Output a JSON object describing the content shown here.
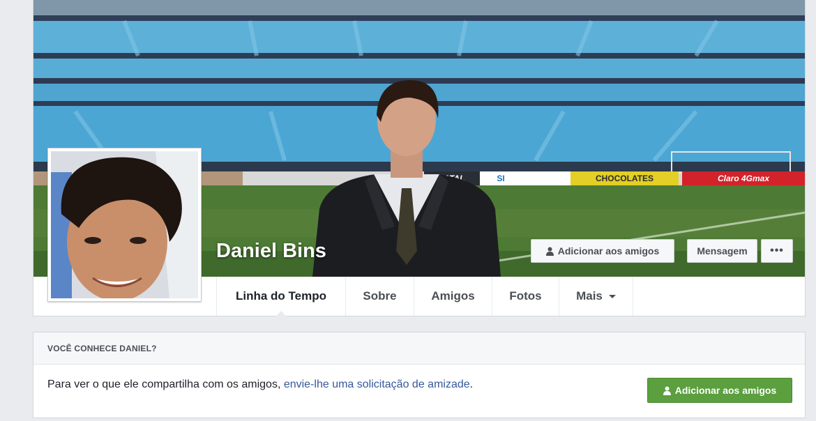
{
  "profile": {
    "name": "Daniel Bins"
  },
  "cover_actions": {
    "add_friend_label": "Adicionar aos amigos",
    "message_label": "Mensagem",
    "more_label": "•••"
  },
  "cover_ads": {
    "chocolates": "CHOCOLATES",
    "claro": "Claro 4Gmax",
    "fatal": "FATAL",
    "si": "SI"
  },
  "tabs": [
    {
      "label": "Linha do Tempo",
      "active": true
    },
    {
      "label": "Sobre"
    },
    {
      "label": "Amigos"
    },
    {
      "label": "Fotos"
    },
    {
      "label": "Mais"
    }
  ],
  "know_card": {
    "heading": "VOCÊ CONHECE DANIEL?",
    "text_prefix": "Para ver o que ele compartilha com os amigos, ",
    "link_text": "envie-lhe uma solicitação de amizade",
    "text_suffix": ".",
    "button_label": "Adicionar aos amigos"
  },
  "colors": {
    "page_bg": "#e9ebee",
    "link": "#365899",
    "green_button": "#5b9f3f"
  }
}
